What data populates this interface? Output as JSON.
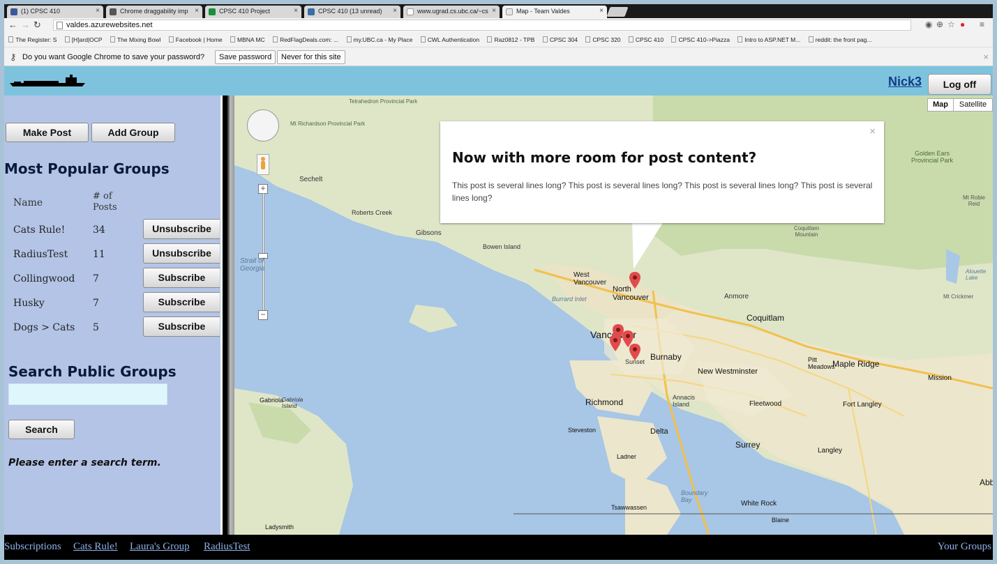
{
  "browser": {
    "tabs": [
      {
        "title": "(1) CPSC 410",
        "color": "#3b5998"
      },
      {
        "title": "Chrome draggability imp",
        "color": "#555555"
      },
      {
        "title": "CPSC 410 Project",
        "color": "#1a8f3c"
      },
      {
        "title": "CPSC 410 (13 unread)",
        "color": "#3a6ea5"
      },
      {
        "title": "www.ugrad.cs.ubc.ca/~cs",
        "color": "#bbbbbb"
      },
      {
        "title": "Map - Team Valdes",
        "color": "#cccccc"
      }
    ],
    "url": "valdes.azurewebsites.net",
    "bookmarks": [
      "The Register: S",
      "[H]ard|OCP",
      "The Mixing Bowl",
      "Facebook | Home",
      "MBNA MC",
      "RedFlagDeals.com: ...",
      "my.UBC.ca - My Place",
      "CWL Authentication",
      "Raz0812 - TPB",
      "CPSC 304",
      "CPSC 320",
      "CPSC 410",
      "CPSC 410->Piazza",
      "Intro to ASP.NET M...",
      "reddit: the front pag..."
    ],
    "infobar": {
      "message": "Do you want Google Chrome to save your password?",
      "save_label": "Save password",
      "never_label": "Never for this site"
    }
  },
  "header": {
    "user": "Nick3",
    "logoff_label": "Log off"
  },
  "sidebar": {
    "make_post_label": "Make Post",
    "add_group_label": "Add Group",
    "popular_title": "Most Popular Groups",
    "col_name": "Name",
    "col_posts": "# of Posts",
    "groups": [
      {
        "name": "Cats Rule!",
        "posts": "34",
        "action": "Unsubscribe"
      },
      {
        "name": "RadiusTest",
        "posts": "11",
        "action": "Unsubscribe"
      },
      {
        "name": "Collingwood",
        "posts": "7",
        "action": "Subscribe"
      },
      {
        "name": "Husky",
        "posts": "7",
        "action": "Subscribe"
      },
      {
        "name": "Dogs > Cats",
        "posts": "5",
        "action": "Subscribe"
      }
    ],
    "search_title": "Search Public Groups",
    "search_value": "",
    "search_label": "Search",
    "search_message": "Please enter a search term."
  },
  "map": {
    "type_map": "Map",
    "type_satellite": "Satellite",
    "labels": [
      "Tetrahedron Provincial Park",
      "Mt Richardson Provincial Park",
      "Sechelt",
      "Roberts Creek",
      "Gibsons",
      "Bowen Island",
      "Strait of Georgia",
      "West Vancouver",
      "North Vancouver",
      "Burrard Inlet",
      "Vancouver",
      "Burnaby",
      "Sunset",
      "Coquitlam",
      "Anmore",
      "New Westminster",
      "Pitt Meadows",
      "Maple Ridge",
      "Mission",
      "Richmond",
      "Annacis Island",
      "Fleetwood",
      "Fort Langley",
      "Steveston",
      "Delta",
      "Surrey",
      "Langley",
      "Ladner",
      "Boundary Bay",
      "White Rock",
      "Tsawwassen",
      "Blaine",
      "Gabriola",
      "Gabriola Island",
      "Ladysmith",
      "Golden Ears Provincial Park",
      "Mt Robie Reid",
      "Alouette Lake",
      "Mt Crickmer",
      "Coquitlam Mountain",
      "Abb"
    ],
    "popup": {
      "title": "Now with more room for post content?",
      "body": "This post is several lines long? This post is several lines long? This post is several lines long? This post is several lines long?"
    }
  },
  "footer": {
    "subscriptions_label": "Subscriptions",
    "links": [
      "Cats Rule!",
      "Laura's Group",
      "RadiusTest"
    ],
    "your_groups_label": "Your Groups"
  }
}
